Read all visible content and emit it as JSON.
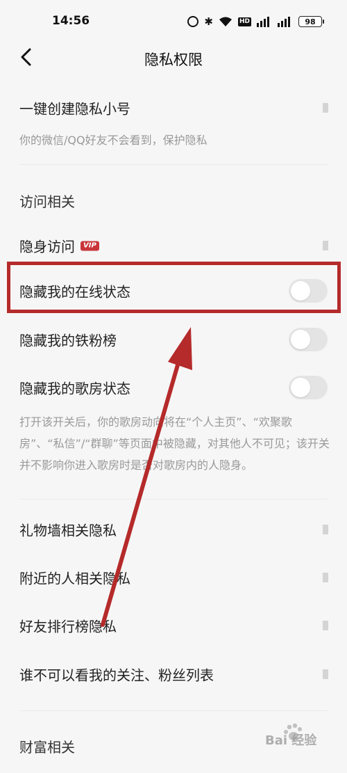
{
  "status_bar": {
    "time": "14:56",
    "battery": "98",
    "hd_label": "HD",
    "network_1": "5G",
    "network_2": "5G",
    "icons": [
      "alarm-icon",
      "bluetooth-icon",
      "wifi-icon",
      "hd-icon",
      "signal-icon",
      "signal-icon",
      "battery-icon"
    ]
  },
  "nav": {
    "title": "隐私权限",
    "back_icon": "chevron-left-icon"
  },
  "top_item": {
    "label": "一键创建隐私小号",
    "description": "你的微信/QQ好友不会看到，保护隐私"
  },
  "section_access": {
    "title": "访问相关",
    "items": [
      {
        "label": "隐身访问",
        "badge": "VIP",
        "control": "chevron"
      },
      {
        "label": "隐藏我的在线状态",
        "control": "toggle",
        "on": false
      },
      {
        "label": "隐藏我的铁粉榜",
        "control": "toggle",
        "on": false
      },
      {
        "label": "隐藏我的歌房状态",
        "control": "toggle",
        "on": false
      }
    ],
    "room_description": "打开该开关后，你的歌房动向将在“个人主页”、“欢聚歌房”、“私信”/“群聊”等页面中被隐藏，对其他人不可见；该开关并不影响你进入歌房时是否对歌房内的人隐身。"
  },
  "privacy_items": [
    {
      "label": "礼物墙相关隐私"
    },
    {
      "label": "附近的人相关隐私"
    },
    {
      "label": "好友排行榜隐私"
    },
    {
      "label": "谁不可以看我的关注、粉丝列表"
    }
  ],
  "section_wealth": {
    "title": "财富相关"
  },
  "watermark": "Bai 经验",
  "colors": {
    "background": "#f6f6f6",
    "highlight": "#b52a2a",
    "toggle_off": "#e4e4e4",
    "vip_badge": "#c8363a"
  }
}
